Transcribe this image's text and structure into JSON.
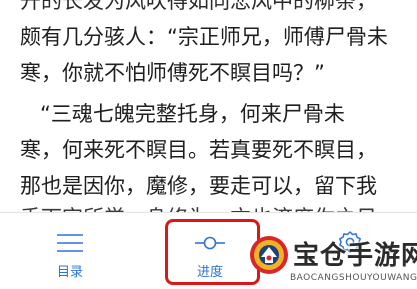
{
  "reader": {
    "lines": [
      "开的长发为风吹得如同悲风中的柳条，",
      "颇有几分骇人：“宗正师兄，师傅尸骨未",
      "寒，你就不怕师傅死不瞑目吗？”",
      "“三魂七魄完整托身，何来尸骨未",
      "寒，何来死不瞑目。若真要死不瞑目，",
      "那也是因你，魔修，要走可以，留下我",
      "手下字所学一身修为，方也济度你之日"
    ]
  },
  "toolbar": {
    "catalog_label": "目录",
    "catalog_icon": "list-icon",
    "progress_label": "进度",
    "progress_icon": "slider-progress-icon",
    "settings_icon": "gear-icon",
    "accent_color": "#2d74d6"
  },
  "highlight": {
    "color": "#e01616"
  },
  "watermark": {
    "title": "宝仓手游网",
    "subtitle": "BAOCANGSHOUYOUWANG"
  }
}
